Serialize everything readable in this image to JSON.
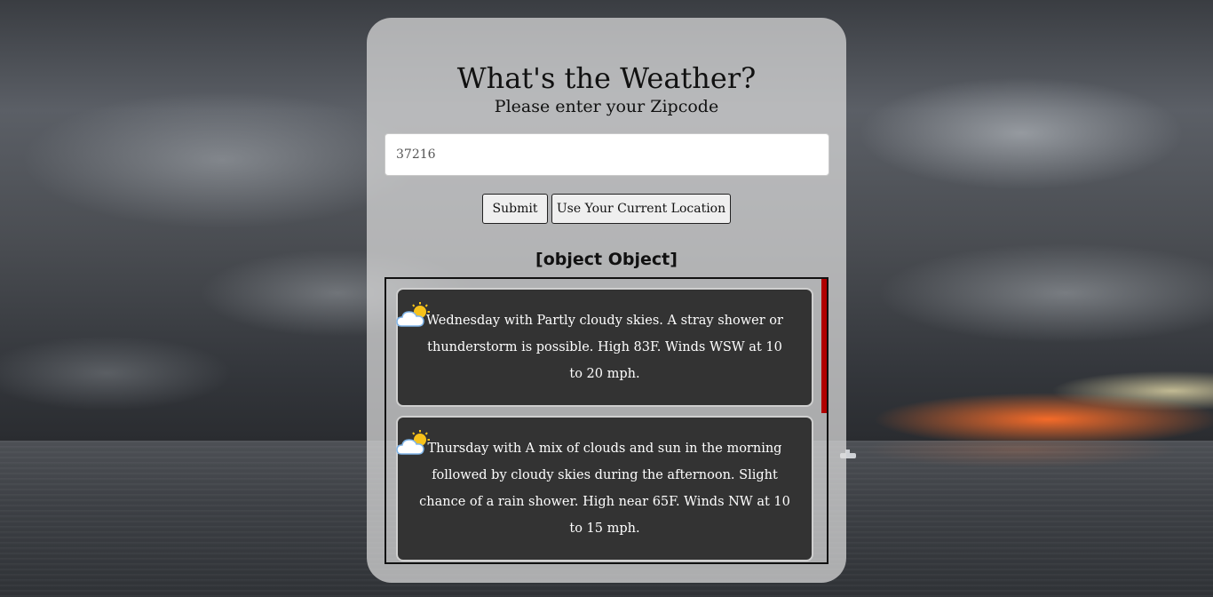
{
  "page": {
    "title": "What's the Weather?",
    "subtitle": "Please enter your Zipcode"
  },
  "search": {
    "value": "37216",
    "placeholder": ""
  },
  "buttons": {
    "submit": "Submit",
    "current_location": "Use Your Current Location"
  },
  "result": {
    "heading": "[object Object]"
  },
  "forecast": [
    {
      "icon": "partly-cloudy-icon",
      "text": "Wednesday with Partly cloudy skies. A stray shower or thunderstorm is possible. High 83F. Winds WSW at 10 to 20 mph."
    },
    {
      "icon": "partly-cloudy-icon",
      "text": "Thursday with A mix of clouds and sun in the morning followed by cloudy skies during the afternoon. Slight chance of a rain shower. High near 65F. Winds NW at 10 to 15 mph."
    }
  ],
  "colors": {
    "card_bg": "#dcdcdc",
    "forecast_bg": "#333333",
    "scrollbar": "#b00000",
    "accent_sunset": "#ff6e28"
  }
}
